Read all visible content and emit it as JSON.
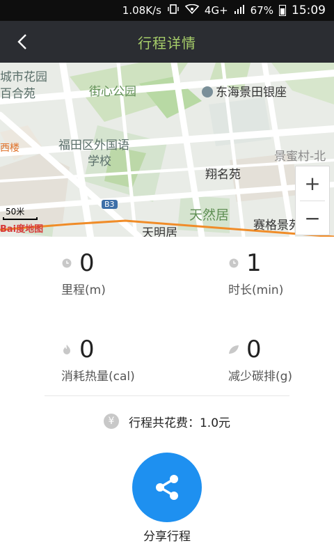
{
  "status_bar": {
    "speed": "1.08K/s",
    "network": "4G+",
    "battery": "67%",
    "time": "15:09"
  },
  "header": {
    "title": "行程详情"
  },
  "map": {
    "labels": [
      "城市花园",
      "百合苑",
      "街心公园",
      "东海景田银座",
      "福田区外国语",
      "学校",
      "景蜜村-北",
      "翔名苑",
      "天然居",
      "赛格景苑",
      "天明居",
      "西楼",
      "B3"
    ],
    "scale": "50米",
    "logo": "Bai度地图",
    "zoom_in": "+",
    "zoom_out": "−"
  },
  "stats": {
    "distance": {
      "value": "0",
      "label": "里程(m)"
    },
    "duration": {
      "value": "1",
      "label": "时长(min)"
    },
    "calories": {
      "value": "0",
      "label": "消耗热量(cal)"
    },
    "carbon": {
      "value": "0",
      "label": "减少碳排(g)"
    }
  },
  "cost": {
    "icon": "¥",
    "text": "行程共花费：1.0元"
  },
  "share": {
    "label": "分享行程"
  },
  "colors": {
    "title": "#a8cf6a",
    "header_bg": "#2b2d32",
    "share": "#1e90f0",
    "route": "#f08c28"
  }
}
